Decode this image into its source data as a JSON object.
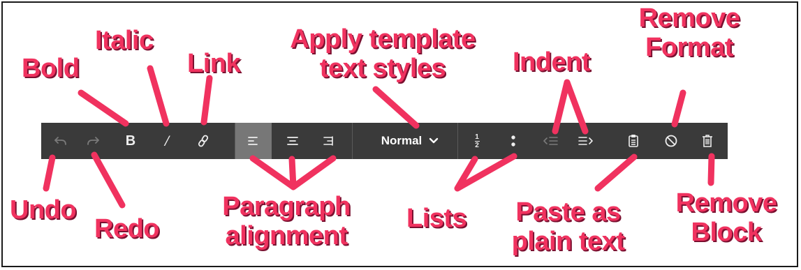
{
  "toolbar": {
    "style_select": {
      "value": "Normal"
    },
    "buttons": [
      {
        "id": "undo",
        "icon": "undo-icon"
      },
      {
        "id": "redo",
        "icon": "redo-icon"
      },
      {
        "id": "bold",
        "icon": "bold-icon",
        "glyph": "B"
      },
      {
        "id": "italic",
        "icon": "italic-icon",
        "glyph": "/"
      },
      {
        "id": "link",
        "icon": "link-icon"
      },
      {
        "id": "align-left",
        "icon": "align-left-icon",
        "active": true
      },
      {
        "id": "align-center",
        "icon": "align-center-icon"
      },
      {
        "id": "align-right",
        "icon": "align-right-icon"
      },
      {
        "id": "ordered-list",
        "icon": "ordered-list-icon",
        "glyph_top": "1",
        "glyph_bottom": "2"
      },
      {
        "id": "unordered-list",
        "icon": "unordered-list-icon"
      },
      {
        "id": "outdent",
        "icon": "outdent-icon"
      },
      {
        "id": "indent",
        "icon": "indent-icon"
      },
      {
        "id": "paste-plain",
        "icon": "clipboard-icon"
      },
      {
        "id": "remove-format",
        "icon": "circle-slash-icon"
      },
      {
        "id": "remove-block",
        "icon": "trash-icon"
      }
    ]
  },
  "annotations": {
    "bold": "Bold",
    "italic": "Italic",
    "link": "Link",
    "apply_template_line1": "Apply template",
    "apply_template_line2": "text styles",
    "indent": "Indent",
    "remove_format_line1": "Remove",
    "remove_format_line2": "Format",
    "undo": "Undo",
    "redo": "Redo",
    "paragraph_line1": "Paragraph",
    "paragraph_line2": "alignment",
    "lists": "Lists",
    "paste_line1": "Paste as",
    "paste_line2": "plain text",
    "remove_block_line1": "Remove",
    "remove_block_line2": "Block"
  },
  "colors": {
    "toolbar_bg": "#3a3a3a",
    "active_button_bg": "#777777",
    "annotation": "#f0325f",
    "icon": "#eeeeee",
    "icon_disabled": "#7a7a7a"
  }
}
